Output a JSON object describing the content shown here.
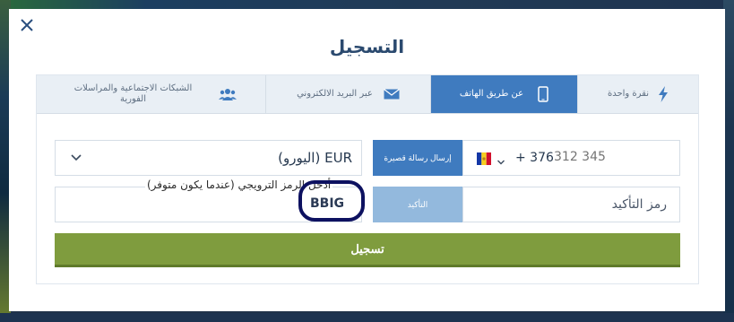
{
  "modal": {
    "title": "التسجيل",
    "close_icon": "close-icon"
  },
  "tabs": [
    {
      "label": "نقرة واحدة",
      "icon": "lightning-icon",
      "active": false
    },
    {
      "label": "عن طريق الهاتف",
      "icon": "mobile-phone-icon",
      "active": true
    },
    {
      "label": "عبر البريد الالكتروني",
      "icon": "envelope-icon",
      "active": false
    },
    {
      "label": "الشبكات الاجتماعية والمراسلات الفورية",
      "icon": "users-icon",
      "active": false
    }
  ],
  "form": {
    "currency": {
      "value": "EUR (اليورو)",
      "icon": "chevron-down-icon"
    },
    "phone": {
      "country_code": "+ 376",
      "placeholder": "312 345",
      "flag": "andorra-flag-icon"
    },
    "send_sms_label": "إرسال رسالة قصيرة",
    "promo": {
      "label": "أدخل الرمز الترويجي (عندما يكون متوفر)",
      "value": "BBIG"
    },
    "confirm_label": "التأكيد",
    "confirmation_code_placeholder": "رمز التأكيد",
    "register_label": "تسجيل"
  },
  "colors": {
    "accent_blue": "#3f7bbf",
    "confirm_blue": "#93b9dd",
    "register_green": "#7f9c3e",
    "highlight_circle": "#0d1160"
  }
}
